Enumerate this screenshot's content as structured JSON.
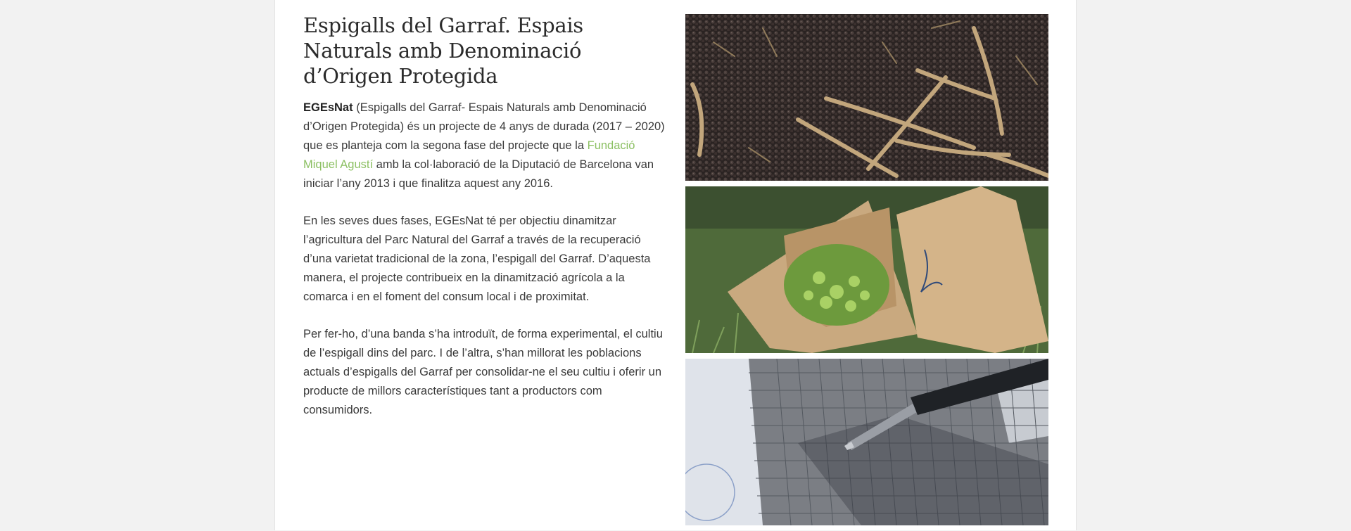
{
  "article": {
    "title": "Espigalls del Garraf. Espais Naturals amb Denominació d’Origen Protegida",
    "para1": {
      "strong": "EGEsNat",
      "text_before_link": " (Espigalls del Garraf- Espais Naturals amb Denominació d’Origen Protegida) és un projecte de 4 anys de durada (2017 – 2020) que es planteja com la segona fase del projecte que la ",
      "link_text": "Fundació Miquel Agustí",
      "text_after_link": " amb la col·laboració de la Diputació de Barcelona van iniciar l’any 2013 i que finalitza aquest any 2016."
    },
    "para2": "En les seves dues fases, EGEsNat té per objectiu dinamitzar l’agricultura del Parc Natural del Garraf a través de la recuperació d’una varietat tradicional de la zona, l’espigall del Garraf. D’aquesta manera, el projecte contribueix en la dinamització agrícola a la comarca i en el foment del consum local i de proximitat.",
    "para3": "Per fer-ho, d’una banda s’ha introduït, de forma experimental, el cultiu de l’espigall dins del parc. I de l’altra, s’han millorat les poblacions actuals d’espigalls del Garraf per consolidar-ne el seu cultiu i oferir un producte de millors característiques tant a productors com consumidors."
  },
  "colors": {
    "link": "#8cc063",
    "text": "#3a3a3a",
    "background": "#f2f2f2"
  }
}
